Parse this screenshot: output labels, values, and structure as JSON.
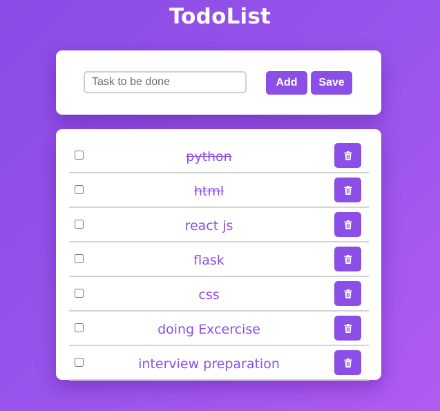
{
  "header": {
    "title": "TodoList"
  },
  "form": {
    "placeholder": "Task to be done",
    "value": "",
    "add_label": "Add",
    "save_label": "Save"
  },
  "tasks": [
    {
      "text": "python",
      "done": true,
      "checked": false
    },
    {
      "text": "html",
      "done": true,
      "checked": false
    },
    {
      "text": "react js",
      "done": false,
      "checked": false
    },
    {
      "text": "flask",
      "done": false,
      "checked": false
    },
    {
      "text": "css",
      "done": false,
      "checked": false
    },
    {
      "text": "doing Excercise",
      "done": false,
      "checked": false
    },
    {
      "text": "interview preparation",
      "done": false,
      "checked": false
    }
  ],
  "icons": {
    "delete": "trash-icon"
  },
  "colors": {
    "accent": "#8b4fe8",
    "background_start": "#8b4be6",
    "background_end": "#b05bf1",
    "card": "#ffffff"
  }
}
